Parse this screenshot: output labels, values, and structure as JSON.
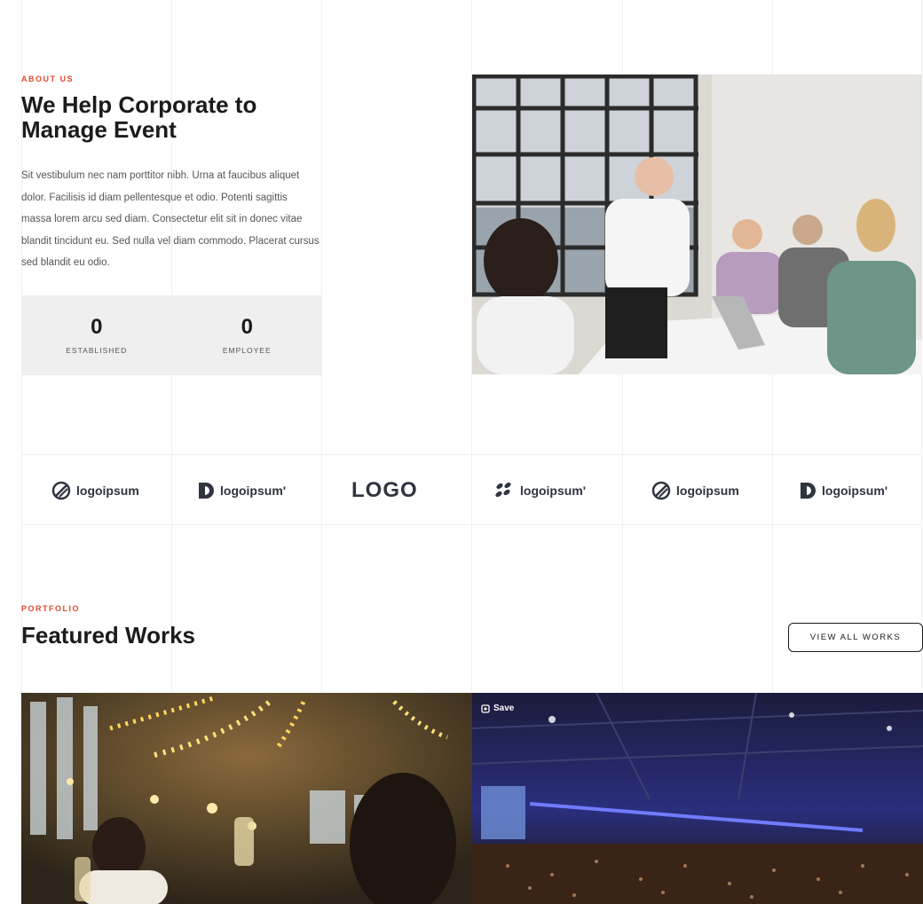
{
  "about": {
    "eyebrow": "ABOUT US",
    "title": "We Help Corporate to Manage Event",
    "text": "Sit vestibulum nec nam porttitor nibh. Urna at faucibus aliquet dolor. Facilisis id diam pellentesque et odio. Potenti sagittis massa lorem arcu sed diam. Consectetur elit sit in donec vitae blandit tincidunt eu. Sed nulla vel diam commodo. Placerat cursus sed blandit eu odio.",
    "stats": [
      {
        "value": "0",
        "label": "ESTABLISHED"
      },
      {
        "value": "0",
        "label": "EMPLOYEE"
      }
    ]
  },
  "logos": [
    {
      "text": "logoipsum",
      "icon": "circle-slash-icon"
    },
    {
      "text": "logoipsum'",
      "icon": "half-shape-icon"
    },
    {
      "text": "LOGO",
      "icon": "wordmark"
    },
    {
      "text": "logoipsum'",
      "icon": "leaves-icon"
    },
    {
      "text": "logoipsum",
      "icon": "circle-slash-icon"
    },
    {
      "text": "logoipsum'",
      "icon": "half-shape-icon"
    }
  ],
  "portfolio": {
    "eyebrow": "PORTFOLIO",
    "title": "Featured Works",
    "view_all": "VIEW ALL WORKS",
    "save_label": "Save"
  },
  "colors": {
    "accent": "#e04a2f",
    "text": "#1b1b1b",
    "stats_bg": "#efefef"
  }
}
